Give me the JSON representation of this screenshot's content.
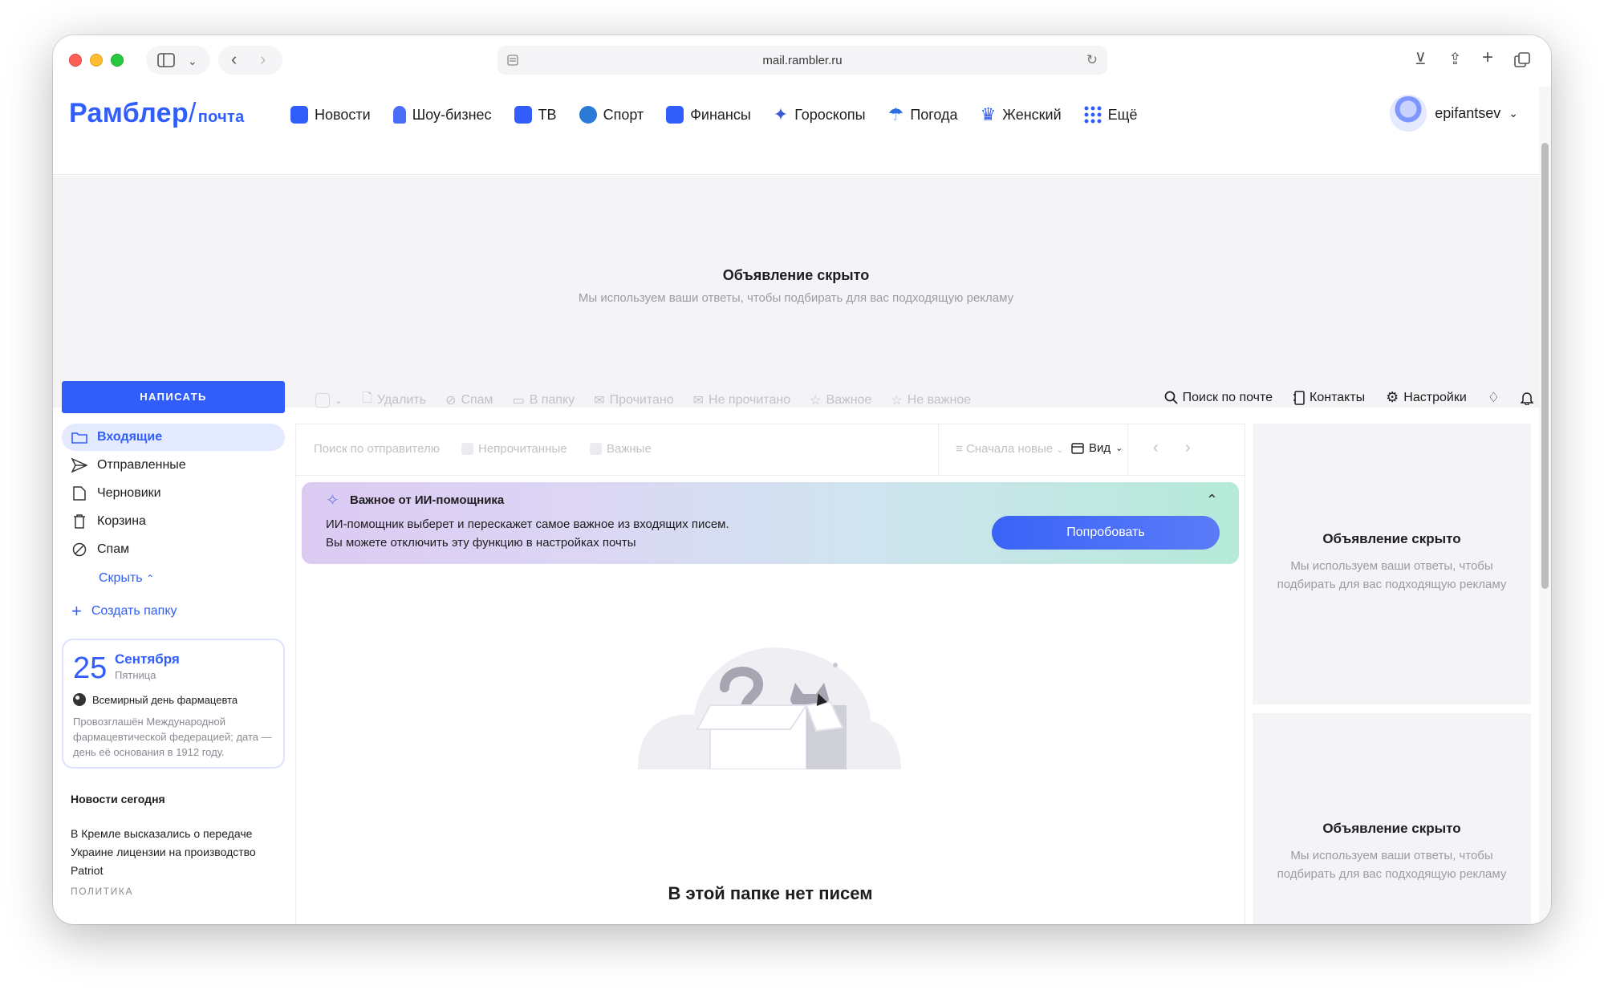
{
  "browser": {
    "url": "mail.rambler.ru"
  },
  "header": {
    "logo": "Рамблер",
    "logo_slash": "/",
    "logo_sub": "почта",
    "nav": [
      {
        "label": "Новости",
        "icon": "news-icon",
        "color": "#315efb"
      },
      {
        "label": "Шоу-бизнес",
        "icon": "microphone-icon",
        "color": "#4a6cf7"
      },
      {
        "label": "ТВ",
        "icon": "tv-icon",
        "color": "#315efb"
      },
      {
        "label": "Спорт",
        "icon": "sport-icon",
        "color": "#2b7bd6"
      },
      {
        "label": "Финансы",
        "icon": "bag-icon",
        "color": "#315efb"
      },
      {
        "label": "Гороскопы",
        "icon": "star-icon",
        "color": "#3a5bd9"
      },
      {
        "label": "Погода",
        "icon": "umbrella-icon",
        "color": "#2f6ee0"
      },
      {
        "label": "Женский",
        "icon": "crown-icon",
        "color": "#315efb"
      },
      {
        "label": "Ещё",
        "icon": "grid-icon",
        "color": "#315efb"
      }
    ],
    "user": "epifantsev"
  },
  "ad_top": {
    "title": "Объявление скрыто",
    "subtitle": "Мы используем ваши ответы, чтобы подбирать для вас подходящую рекламу"
  },
  "sidebar": {
    "compose": "НАПИСАТЬ",
    "folders": [
      {
        "label": "Входящие",
        "icon": "folder-icon",
        "active": true
      },
      {
        "label": "Отправленные",
        "icon": "send-icon"
      },
      {
        "label": "Черновики",
        "icon": "draft-icon"
      },
      {
        "label": "Корзина",
        "icon": "trash-icon"
      },
      {
        "label": "Спам",
        "icon": "spam-icon"
      }
    ],
    "hide": "Скрыть",
    "create_folder": "Создать папку",
    "calendar": {
      "day": "25",
      "month": "Сентября",
      "weekday": "Пятница",
      "event": "Всемирный день фармацевта",
      "description": "Провозглашён Международной фармацевтической федерацией; дата — день её основания в 1912 году."
    },
    "news": {
      "heading": "Новости сегодня",
      "item": "В Кремле высказались о передаче Украине лицензии на производство Patriot",
      "category": "ПОЛИТИКА"
    }
  },
  "actions": {
    "delete": "Удалить",
    "spam": "Спам",
    "to_folder": "В папку",
    "read": "Прочитано",
    "unread": "Не прочитано",
    "important": "Важное",
    "not_important": "Не важное"
  },
  "tools": {
    "search": "Поиск по почте",
    "contacts": "Контакты",
    "settings": "Настройки"
  },
  "filters": {
    "search_sender": "Поиск по отправителю",
    "unread": "Непрочитанные",
    "important": "Важные",
    "sort": "Сначала новые",
    "view": "Вид"
  },
  "ai_banner": {
    "title": "Важное от ИИ-помощника",
    "line1": "ИИ-помощник выберет и перескажет самое важное из входящих писем.",
    "line2": "Вы можете отключить эту функцию в настройках почты",
    "button": "Попробовать"
  },
  "empty": {
    "text": "В этой папке нет писем"
  },
  "ad_side": [
    {
      "title": "Объявление скрыто",
      "subtitle": "Мы используем ваши ответы, чтобы подбирать для вас подходящую рекламу"
    },
    {
      "title": "Объявление скрыто",
      "subtitle": "Мы используем ваши ответы, чтобы подбирать для вас подходящую рекламу"
    }
  ]
}
